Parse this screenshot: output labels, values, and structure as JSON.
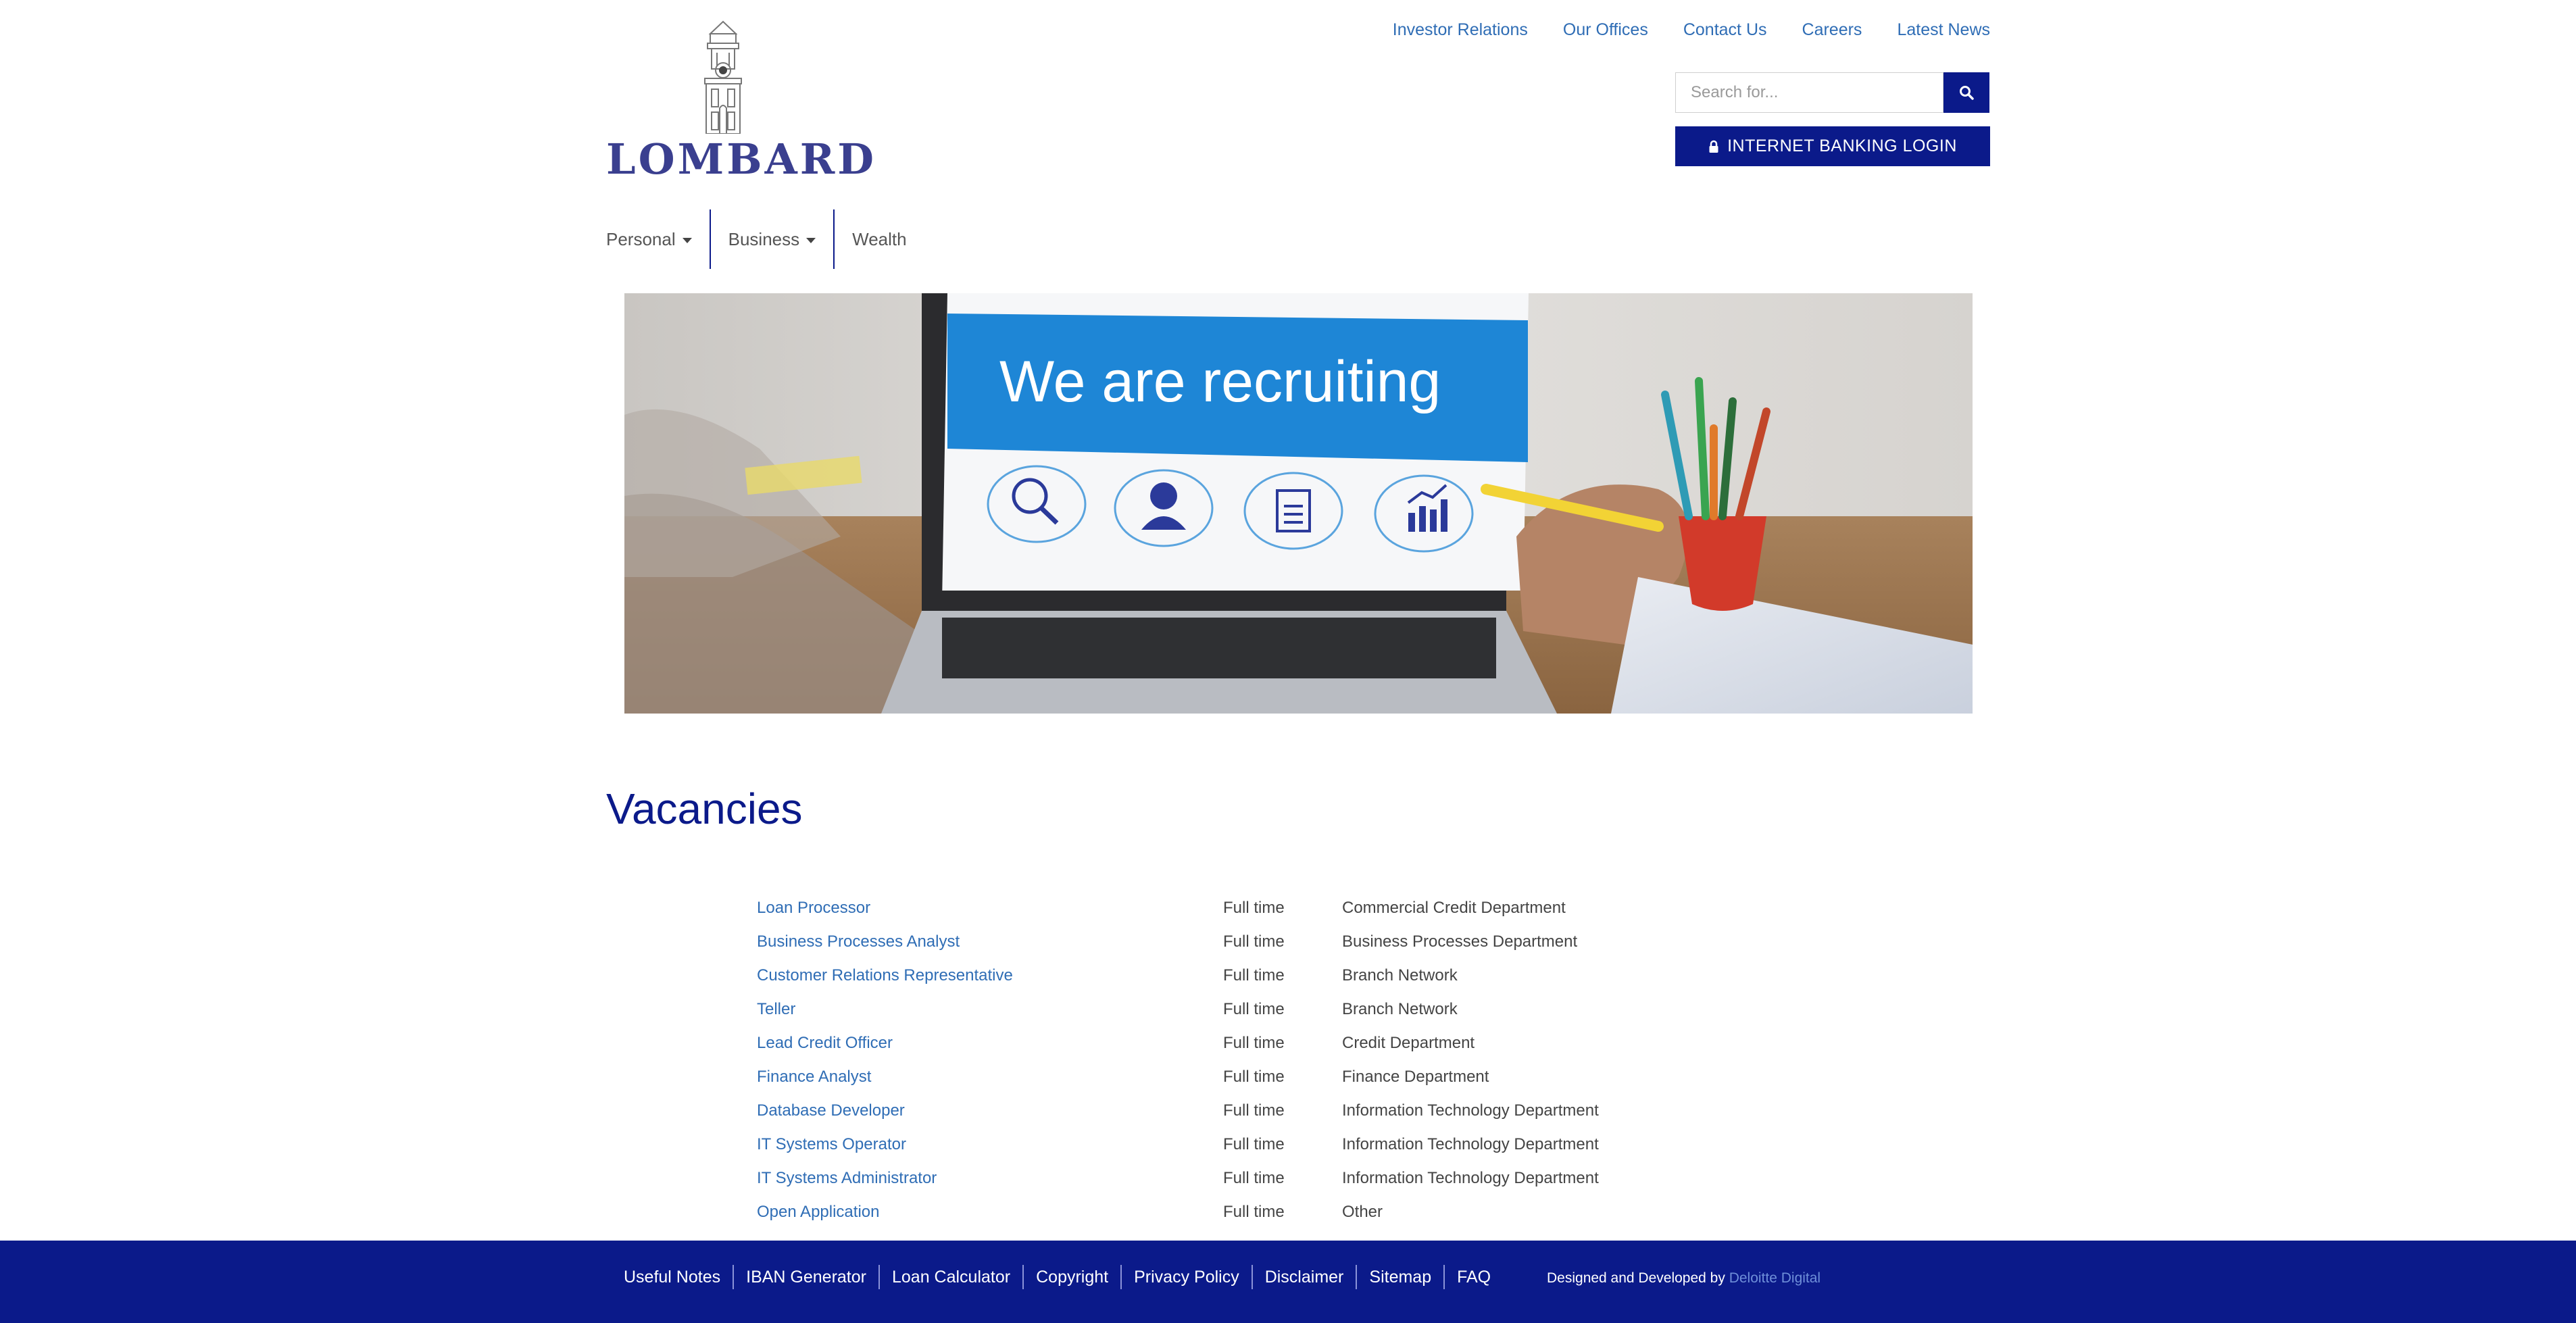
{
  "brand": {
    "name": "LOMBARD",
    "logo_icon": "building-tower-icon"
  },
  "top_links": [
    "Investor Relations",
    "Our Offices",
    "Contact Us",
    "Careers",
    "Latest News"
  ],
  "search": {
    "placeholder": "Search for...",
    "icon": "search-icon"
  },
  "login": {
    "label": "INTERNET BANKING LOGIN",
    "icon": "lock-icon"
  },
  "main_nav": [
    {
      "label": "Personal",
      "dropdown": true
    },
    {
      "label": "Business",
      "dropdown": true
    },
    {
      "label": "Wealth",
      "dropdown": false
    }
  ],
  "hero": {
    "headline": "We are recruiting"
  },
  "vacancies": {
    "title": "Vacancies",
    "rows": [
      {
        "title": "Loan Processor",
        "type": "Full time",
        "department": "Commercial Credit Department"
      },
      {
        "title": "Business Processes Analyst",
        "type": "Full time",
        "department": "Business Processes Department"
      },
      {
        "title": "Customer Relations Representative",
        "type": "Full time",
        "department": "Branch Network"
      },
      {
        "title": "Teller",
        "type": "Full time",
        "department": "Branch Network"
      },
      {
        "title": "Lead Credit Officer",
        "type": "Full time",
        "department": "Credit Department"
      },
      {
        "title": "Finance Analyst",
        "type": "Full time",
        "department": "Finance Department"
      },
      {
        "title": "Database Developer",
        "type": "Full time",
        "department": "Information Technology Department"
      },
      {
        "title": "IT Systems Operator",
        "type": "Full time",
        "department": "Information Technology Department"
      },
      {
        "title": "IT Systems Administrator",
        "type": "Full time",
        "department": "Information Technology Department"
      },
      {
        "title": "Open Application",
        "type": "Full time",
        "department": "Other"
      }
    ]
  },
  "footer": {
    "links": [
      "Useful Notes",
      "IBAN Generator",
      "Loan Calculator",
      "Copyright",
      "Privacy Policy",
      "Disclaimer",
      "Sitemap",
      "FAQ"
    ],
    "credit_prefix": "Designed and Developed by",
    "credit_name": "Deloitte Digital"
  },
  "colors": {
    "brand_navy": "#0b1a8a",
    "link_blue": "#2f6db5",
    "hero_blue": "#1177cc"
  }
}
